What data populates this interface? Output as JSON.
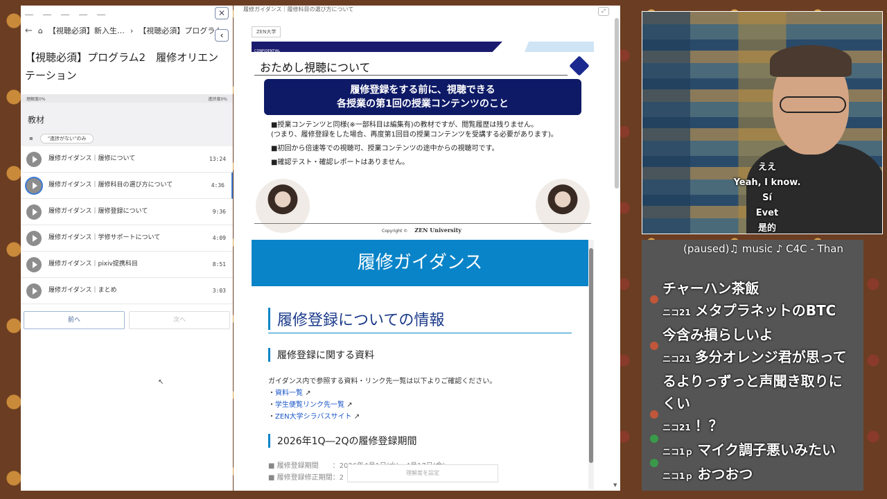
{
  "left": {
    "breadcrumb": [
      "【視聴必須】新入生…",
      "【視聴必須】プログラム"
    ],
    "title": "【視聴必須】プログラム2　履修オリエンテーション",
    "progress_understanding": "理解度0%",
    "progress_progress": "進捗度0%",
    "materials_heading": "教材",
    "filter_chip": "\"進捗がない\"のみ",
    "items": [
      {
        "title": "履修ガイダンス｜履修について",
        "duration": "13:24"
      },
      {
        "title": "履修ガイダンス｜履修科目の選び方について",
        "duration": "4:36"
      },
      {
        "title": "履修ガイダンス｜履修登録について",
        "duration": "9:36"
      },
      {
        "title": "履修ガイダンス｜学修サポートについて",
        "duration": "4:09"
      },
      {
        "title": "履修ガイダンス｜pixiv提携科目",
        "duration": "8:51"
      },
      {
        "title": "履修ガイダンス｜まとめ",
        "duration": "3:03"
      }
    ],
    "prev_label": "前へ",
    "next_label": "次へ"
  },
  "slide": {
    "top_text": "履修ガイダンス｜履修科目の選び方について",
    "zen_tag": "ZEN大学",
    "confidential": "CONFIDENTIAL",
    "title": "おためし視聴について",
    "box_line1": "履修登録をする前に、視聴できる",
    "box_line2": "各授業の第1回の授業コンテンツのこと",
    "bullet1a": "■授業コンテンツと同様(※一部科目は編集有)の教材ですが、閲覧履歴は残りません。",
    "bullet1b": "(つまり、履修登録をした場合、再度第1回目の授業コンテンツを受講する必要があります)。",
    "bullet2": "■初回から倍速等での視聴可、授業コンテンツの途中からの視聴可です。",
    "bullet3": "■確認テスト・確認レポートはありません。",
    "copyright": "Copyright ©",
    "copyright_brand": "ZEN University"
  },
  "guide": {
    "header": "履修ガイダンス",
    "h2": "履修登録についての情報",
    "h3_materials": "履修登録に関する資料",
    "intro": "ガイダンス内で参照する資料・リンク先一覧は以下よりご確認ください。",
    "links": [
      "資料一覧",
      "学生便覧リンク先一覧",
      "ZEN大学シラバスサイト"
    ],
    "h3_period": "2026年1Q―2Qの履修登録期間",
    "period1": "履修登録期間　　：2026年4月1日(水)～4月17日(金)",
    "period2": "履修登録修正期間：2",
    "understand_btn": "理解度を設定"
  },
  "webcam": {
    "subs": [
      "ええ",
      "Yeah, I know.",
      "Sí",
      "Evet",
      "是的"
    ]
  },
  "chat": {
    "now_playing": "(paused)♫ music ♪ C4C - Than",
    "messages": [
      {
        "user": "",
        "text": "チャーハン茶飯",
        "badge": ""
      },
      {
        "user": "ニコ21",
        "text": "メタプラネットのBTC今含み損らしいよ",
        "badge": "orange"
      },
      {
        "user": "ニコ21",
        "text": "多分オレンジ君が思ってるよりっずっと声聞き取りにくい",
        "badge": "orange"
      },
      {
        "user": "ニコ21",
        "text": "！？",
        "badge": "orange"
      },
      {
        "user": "ニコ1ｐ",
        "text": "マイク調子悪いみたい",
        "badge": "green"
      },
      {
        "user": "ニコ1ｐ",
        "text": "おつおつ",
        "badge": "green"
      }
    ]
  }
}
